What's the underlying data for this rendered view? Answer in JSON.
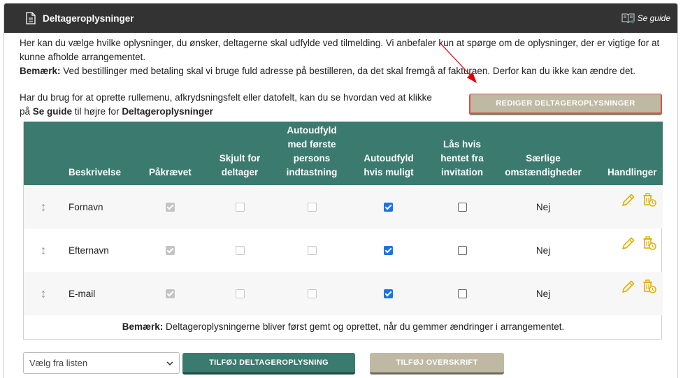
{
  "header": {
    "title": "Deltageroplysninger",
    "guide_label": "Se guide"
  },
  "intro": {
    "text": "Her kan du vælge hvilke oplysninger, du ønsker, deltagerne skal udfylde ved tilmelding. Vi anbefaler kun at spørge om de oplysninger, der er vigtige for at kunne afholde arrangementet.",
    "note_label": "Bemærk:",
    "note_text": " Ved bestillinger med betaling skal vi bruge fuld adresse på bestilleren, da det skal fremgå af fakturaen. Derfor kan du ikke kan ændre det."
  },
  "help": {
    "text1": "Har du brug for at oprette rullemenu, afkrydsningsfelt eller datofelt, kan du se hvordan ved at klikke på ",
    "bold1": "Se guide",
    "text2": " til højre for ",
    "bold2": "Deltageroplysninger"
  },
  "buttons": {
    "edit": "REDIGER DELTAGEROPLYSNINGER",
    "add": "TILFØJ DELTAGEROPLYSNING",
    "add_heading": "TILFØJ OVERSKRIFT"
  },
  "table": {
    "headers": {
      "description": "Beskrivelse",
      "required": "Påkrævet",
      "hidden_l1": "Skjult for",
      "hidden_l2": "deltager",
      "autofill_first_l1": "Autoudfyld",
      "autofill_first_l2": "med første",
      "autofill_first_l3": "persons",
      "autofill_first_l4": "indtastning",
      "autofill_l1": "Autoudfyld",
      "autofill_l2": "hvis muligt",
      "lock_l1": "Lås hvis",
      "lock_l2": "hentet fra",
      "lock_l3": "invitation",
      "special_l1": "Særlige",
      "special_l2": "omstændigheder",
      "actions": "Handlinger"
    },
    "rows": [
      {
        "description": "Fornavn",
        "required": true,
        "hidden": false,
        "autofill_first": false,
        "autofill": true,
        "lock": false,
        "special": "Nej"
      },
      {
        "description": "Efternavn",
        "required": true,
        "hidden": false,
        "autofill_first": false,
        "autofill": true,
        "lock": false,
        "special": "Nej"
      },
      {
        "description": "E-mail",
        "required": true,
        "hidden": false,
        "autofill_first": false,
        "autofill": true,
        "lock": false,
        "special": "Nej"
      }
    ],
    "note_label": "Bemærk:",
    "note_text": " Deltageroplysningerne bliver først gemt og oprettet, når du gemmer ændringer i arrangementet."
  },
  "select": {
    "value": "Vælg fra listen"
  },
  "colors": {
    "header_bg": "#333333",
    "table_header_bg": "#3b7a6e",
    "accent_button": "#3b7a6e",
    "neutral_button": "#bfb8a3",
    "checkbox_blue": "#1a73e8",
    "icon_yellow": "#e0b000",
    "arrow_red": "#e00000"
  }
}
